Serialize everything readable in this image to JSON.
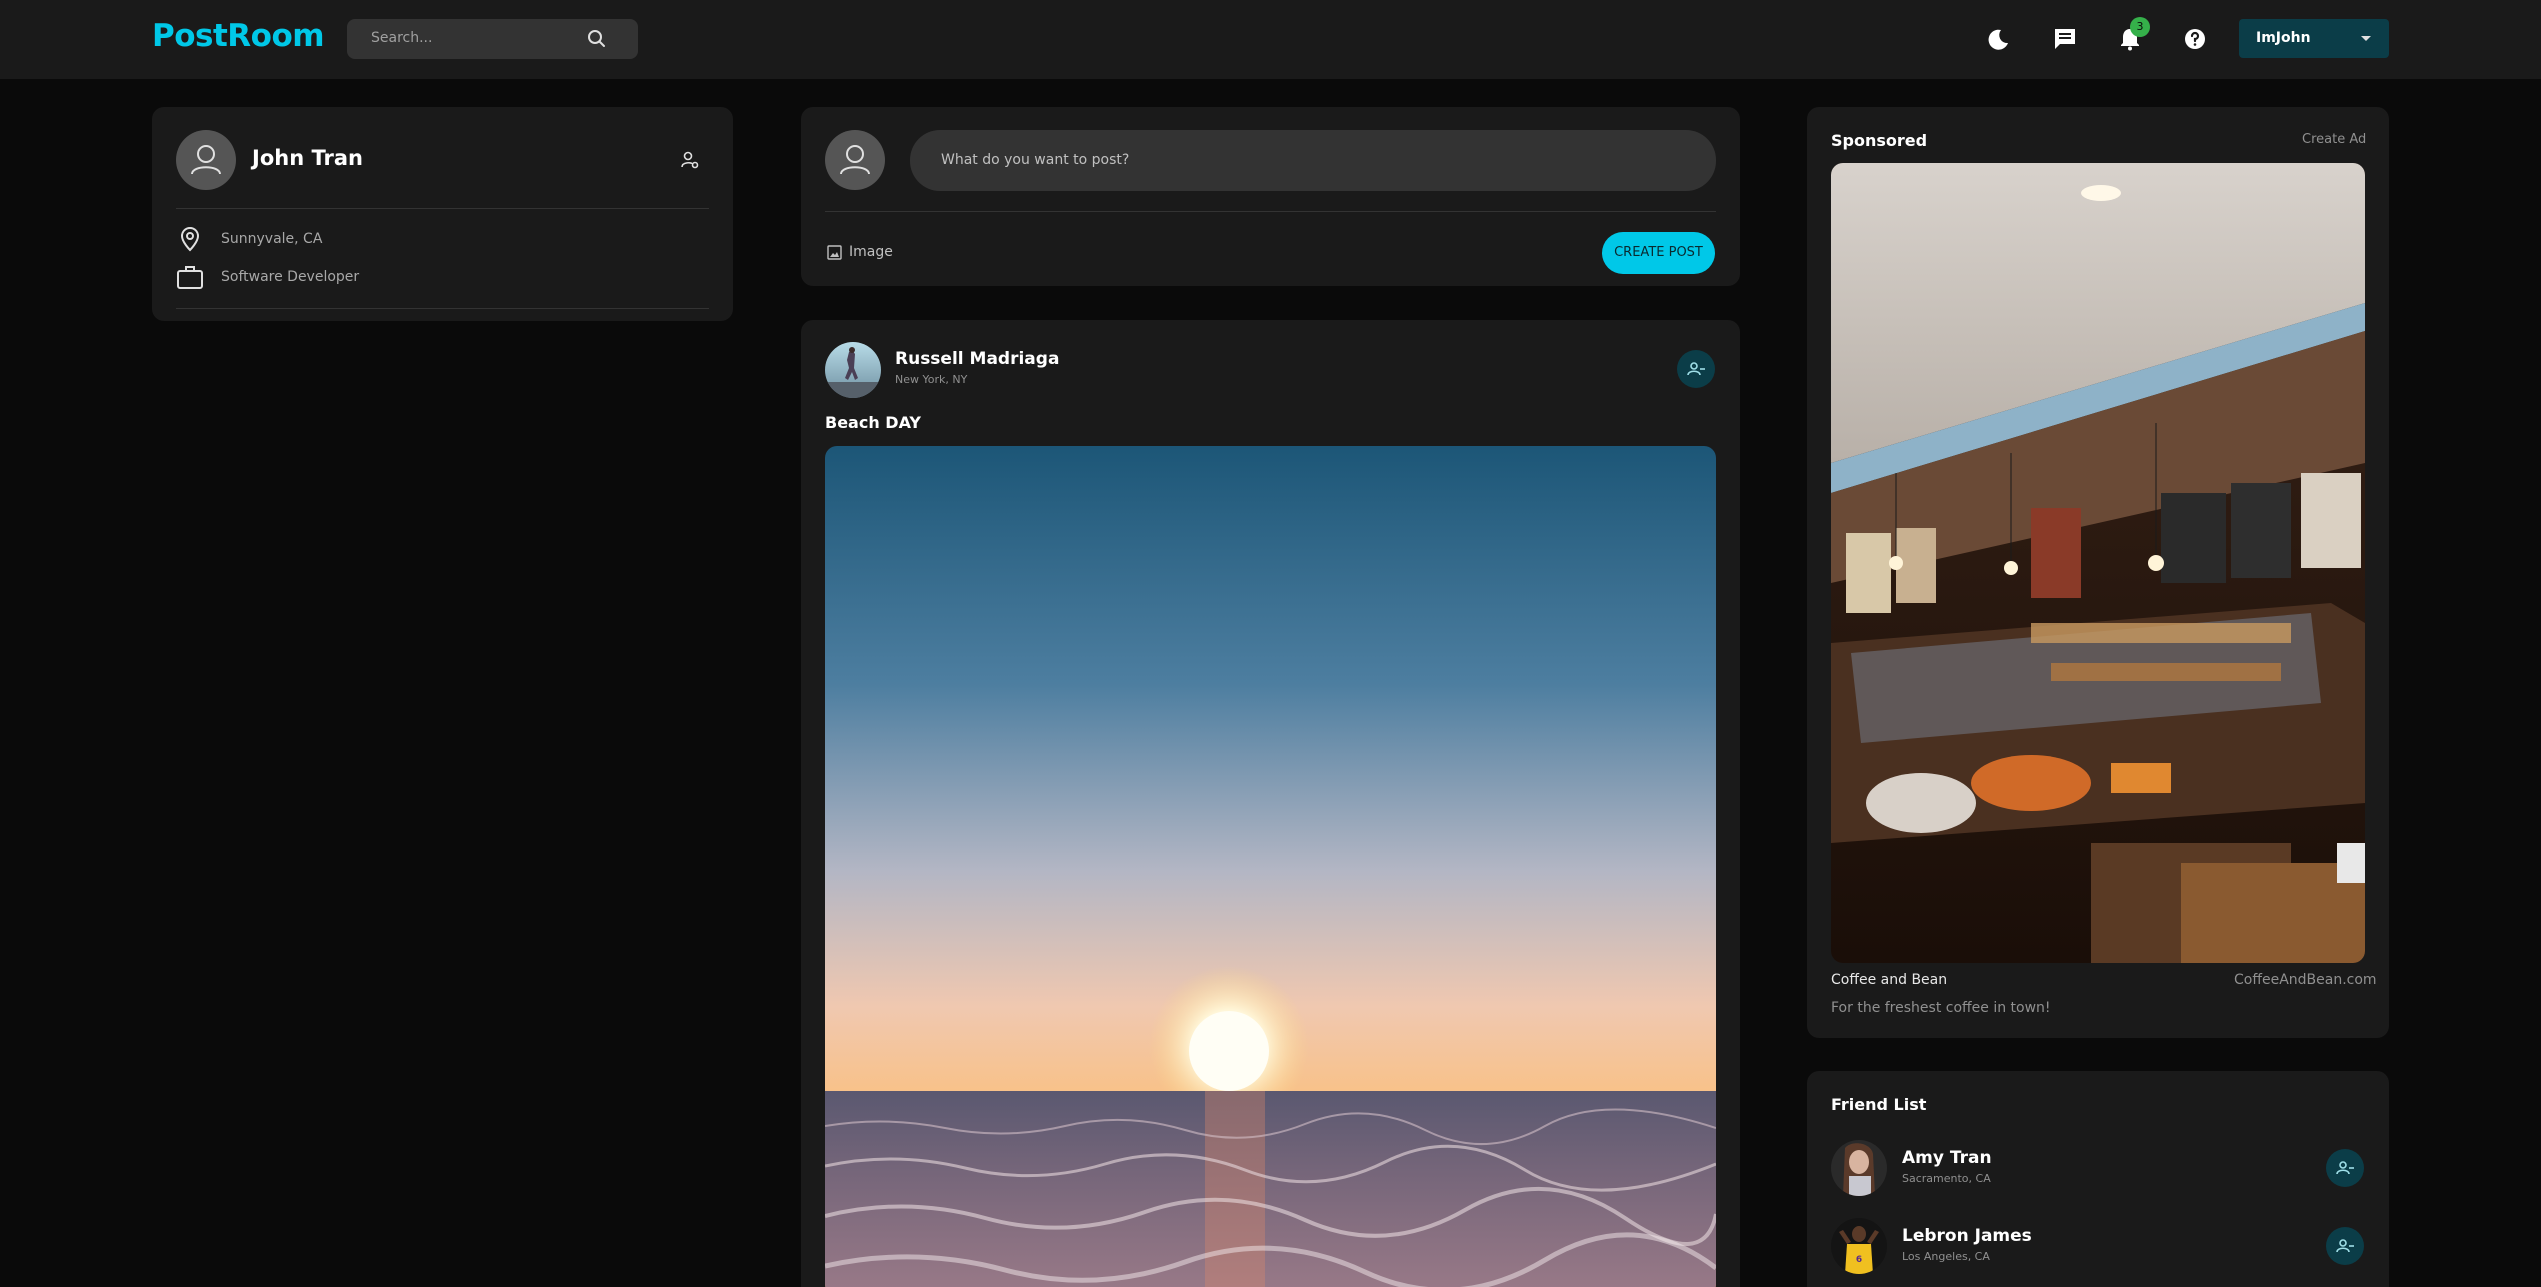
{
  "navbar": {
    "brand": "PostRoom",
    "search_placeholder": "Search...",
    "notification_count": "3",
    "user_menu_label": "ImJohn"
  },
  "profile": {
    "name": "John Tran",
    "location": "Sunnyvale, CA",
    "occupation": "Software Developer"
  },
  "composer": {
    "placeholder": "What do you want to post?",
    "image_label": "Image",
    "create_label": "CREATE POST"
  },
  "post": {
    "author": "Russell Madriaga",
    "author_location": "New York, NY",
    "text": "Beach DAY"
  },
  "sponsored": {
    "title": "Sponsored",
    "create_ad_label": "Create Ad",
    "ad_name": "Coffee and Bean",
    "ad_site": "CoffeeAndBean.com",
    "ad_tagline": "For the freshest coffee in town!"
  },
  "friend_list": {
    "title": "Friend List",
    "friends": [
      {
        "name": "Amy Tran",
        "location": "Sacramento, CA"
      },
      {
        "name": "Lebron James",
        "location": "Los Angeles, CA"
      }
    ]
  },
  "colors": {
    "accent": "#00c8e8",
    "background": "#0a0a0a",
    "card": "#1a1a1a",
    "badge": "#35b04a"
  }
}
